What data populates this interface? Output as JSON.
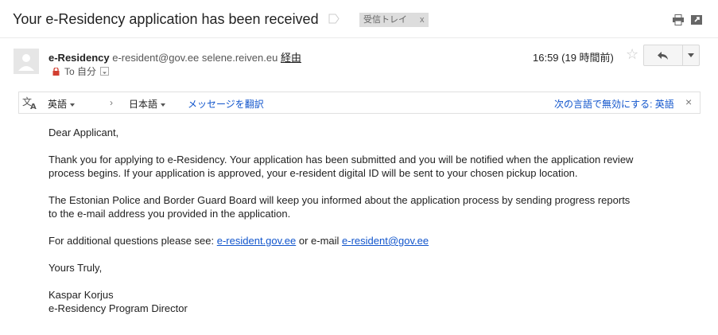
{
  "subject": "Your e-Residency application has been received",
  "label": {
    "name": "受信トレイ",
    "remove": "x"
  },
  "sender": {
    "name": "e-Residency",
    "email": "e-resident@gov.ee",
    "via_domain": "selene.reiven.eu",
    "via_label": "経由"
  },
  "recipient": {
    "to_label": "To 自分"
  },
  "date": "16:59 (19 時間前)",
  "translate": {
    "source_lang": "英語",
    "arrow": "›",
    "target_lang": "日本語",
    "translate_link": "メッセージを翻訳",
    "disable_link": "次の言語で無効にする: 英語",
    "close": "×"
  },
  "body": {
    "greeting": "Dear Applicant,",
    "paragraph1_line1": "Thank you for applying to e-Residency. Your application has been submitted and you will be notified when the application review",
    "paragraph1_line2": "process begins. If your application is approved, your e-resident digital ID will be sent to your chosen pickup location.",
    "paragraph2_line1": "The Estonian Police and Border Guard Board will keep you informed about the application process by sending progress reports",
    "paragraph2_line2": "to the e-mail address you provided in the application.",
    "questions_prefix": "For additional questions please see: ",
    "questions_link1": "e-resident.gov.ee",
    "questions_middle": " or e-mail ",
    "questions_link2": "e-resident@gov.ee",
    "closing": "Yours Truly,",
    "signature_name": "Kaspar Korjus",
    "signature_title": "e-Residency Program Director"
  }
}
